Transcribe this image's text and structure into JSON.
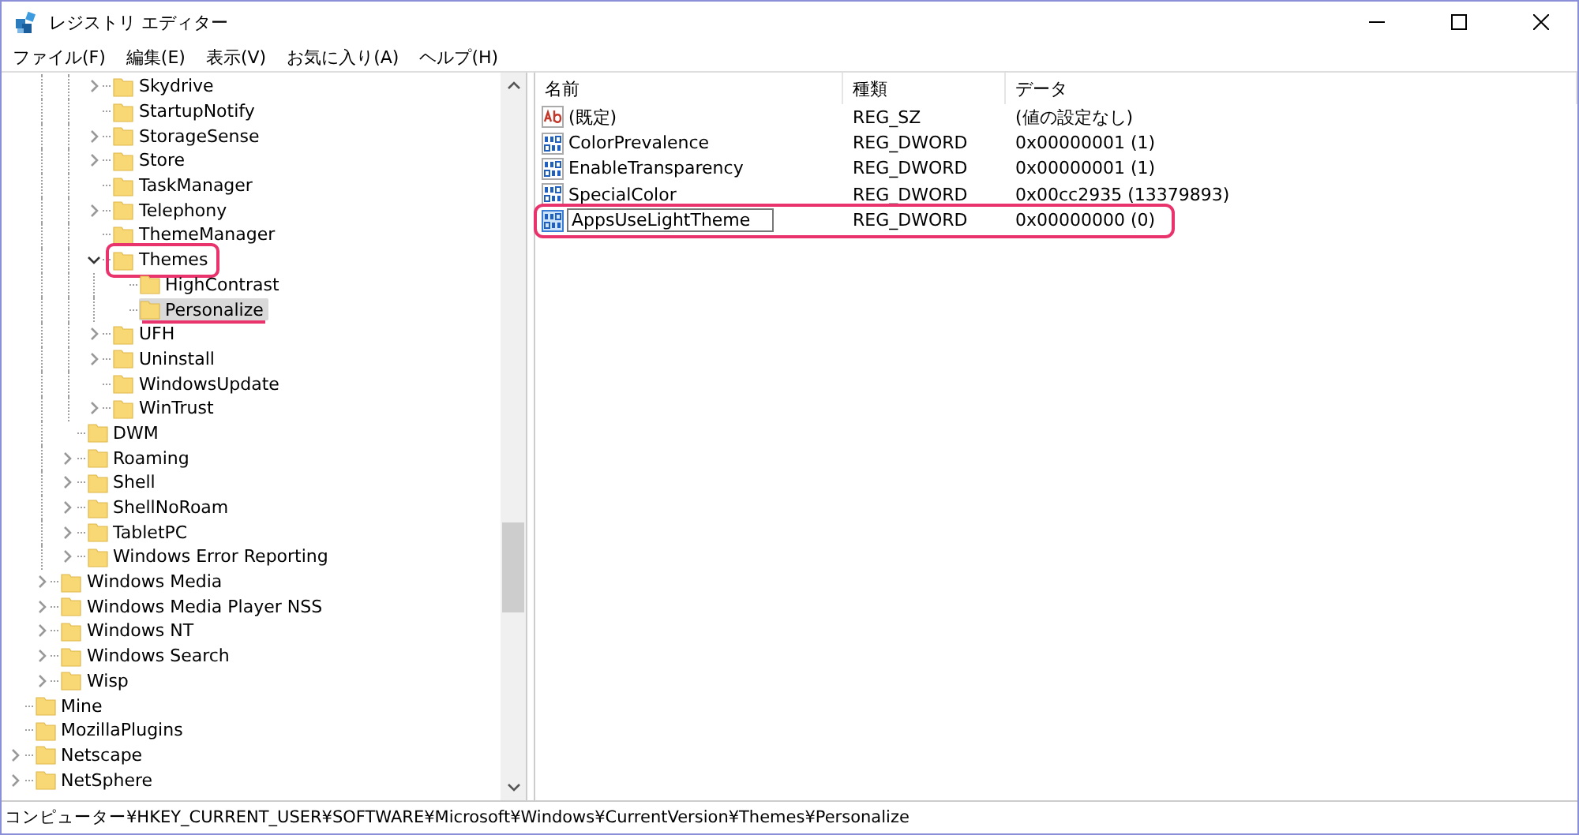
{
  "window": {
    "title": "レジストリ エディター"
  },
  "menu": [
    "ファイル(F)",
    "編集(E)",
    "表示(V)",
    "お気に入り(A)",
    "ヘルプ(H)"
  ],
  "tree": {
    "children": [
      {
        "children": [
          {
            "children": [
              {
                "children": [
                  {
                    "label": "Skydrive",
                    "expandable": true,
                    "expanded": false,
                    "selected": false
                  },
                  {
                    "label": "StartupNotify",
                    "expandable": false,
                    "selected": false
                  },
                  {
                    "label": "StorageSense",
                    "expandable": true,
                    "expanded": false,
                    "selected": false
                  },
                  {
                    "label": "Store",
                    "expandable": true,
                    "expanded": false,
                    "selected": false
                  },
                  {
                    "label": "TaskManager",
                    "expandable": false,
                    "selected": false
                  },
                  {
                    "label": "Telephony",
                    "expandable": true,
                    "expanded": false,
                    "selected": false
                  },
                  {
                    "label": "ThemeManager",
                    "expandable": false,
                    "selected": false
                  },
                  {
                    "label": "Themes",
                    "expandable": true,
                    "expanded": true,
                    "selected": false,
                    "boxed": true,
                    "children": [
                      {
                        "label": "HighContrast",
                        "expandable": false,
                        "selected": false
                      },
                      {
                        "label": "Personalize",
                        "expandable": false,
                        "selected": true,
                        "underlined": true
                      }
                    ]
                  },
                  {
                    "label": "UFH",
                    "expandable": true,
                    "expanded": false,
                    "selected": false
                  },
                  {
                    "label": "Uninstall",
                    "expandable": true,
                    "expanded": false,
                    "selected": false
                  },
                  {
                    "label": "WindowsUpdate",
                    "expandable": false,
                    "selected": false
                  },
                  {
                    "label": "WinTrust",
                    "expandable": true,
                    "expanded": false,
                    "selected": false
                  }
                ]
              },
              {
                "label": "DWM",
                "expandable": false,
                "selected": false
              },
              {
                "label": "Roaming",
                "expandable": true,
                "expanded": false,
                "selected": false
              },
              {
                "label": "Shell",
                "expandable": true,
                "expanded": false,
                "selected": false
              },
              {
                "label": "ShellNoRoam",
                "expandable": true,
                "expanded": false,
                "selected": false
              },
              {
                "label": "TabletPC",
                "expandable": true,
                "expanded": false,
                "selected": false
              },
              {
                "label": "Windows Error Reporting",
                "expandable": true,
                "expanded": false,
                "selected": false
              }
            ]
          },
          {
            "label": "Windows Media",
            "expandable": true,
            "expanded": false,
            "selected": false
          },
          {
            "label": "Windows Media Player NSS",
            "expandable": true,
            "expanded": false,
            "selected": false
          },
          {
            "label": "Windows NT",
            "expandable": true,
            "expanded": false,
            "selected": false
          },
          {
            "label": "Windows Search",
            "expandable": true,
            "expanded": false,
            "selected": false
          },
          {
            "label": "Wisp",
            "expandable": true,
            "expanded": false,
            "selected": false
          }
        ]
      },
      {
        "label": "Mine",
        "expandable": false,
        "selected": false
      },
      {
        "label": "MozillaPlugins",
        "expandable": false,
        "selected": false
      },
      {
        "label": "Netscape",
        "expandable": true,
        "expanded": false,
        "selected": false
      },
      {
        "label": "NetSphere",
        "expandable": true,
        "expanded": false,
        "selected": false
      }
    ]
  },
  "table": {
    "columns": [
      "名前",
      "種類",
      "データ"
    ],
    "rows": [
      {
        "kind": "string",
        "name": "(既定)",
        "type": "REG_SZ",
        "data": "(値の設定なし)",
        "editing": false,
        "annotated": false
      },
      {
        "kind": "binary",
        "name": "ColorPrevalence",
        "type": "REG_DWORD",
        "data": "0x00000001 (1)",
        "editing": false,
        "annotated": false
      },
      {
        "kind": "binary",
        "name": "EnableTransparency",
        "type": "REG_DWORD",
        "data": "0x00000001 (1)",
        "editing": false,
        "annotated": false
      },
      {
        "kind": "binary",
        "name": "SpecialColor",
        "type": "REG_DWORD",
        "data": "0x00cc2935 (13379893)",
        "editing": false,
        "annotated": false
      },
      {
        "kind": "binary",
        "name": "AppsUseLightTheme",
        "type": "REG_DWORD",
        "data": "0x00000000 (0)",
        "editing": true,
        "annotated": true
      }
    ]
  },
  "status_bar": "コンピューター¥HKEY_CURRENT_USER¥SOFTWARE¥Microsoft¥Windows¥CurrentVersion¥Themes¥Personalize"
}
